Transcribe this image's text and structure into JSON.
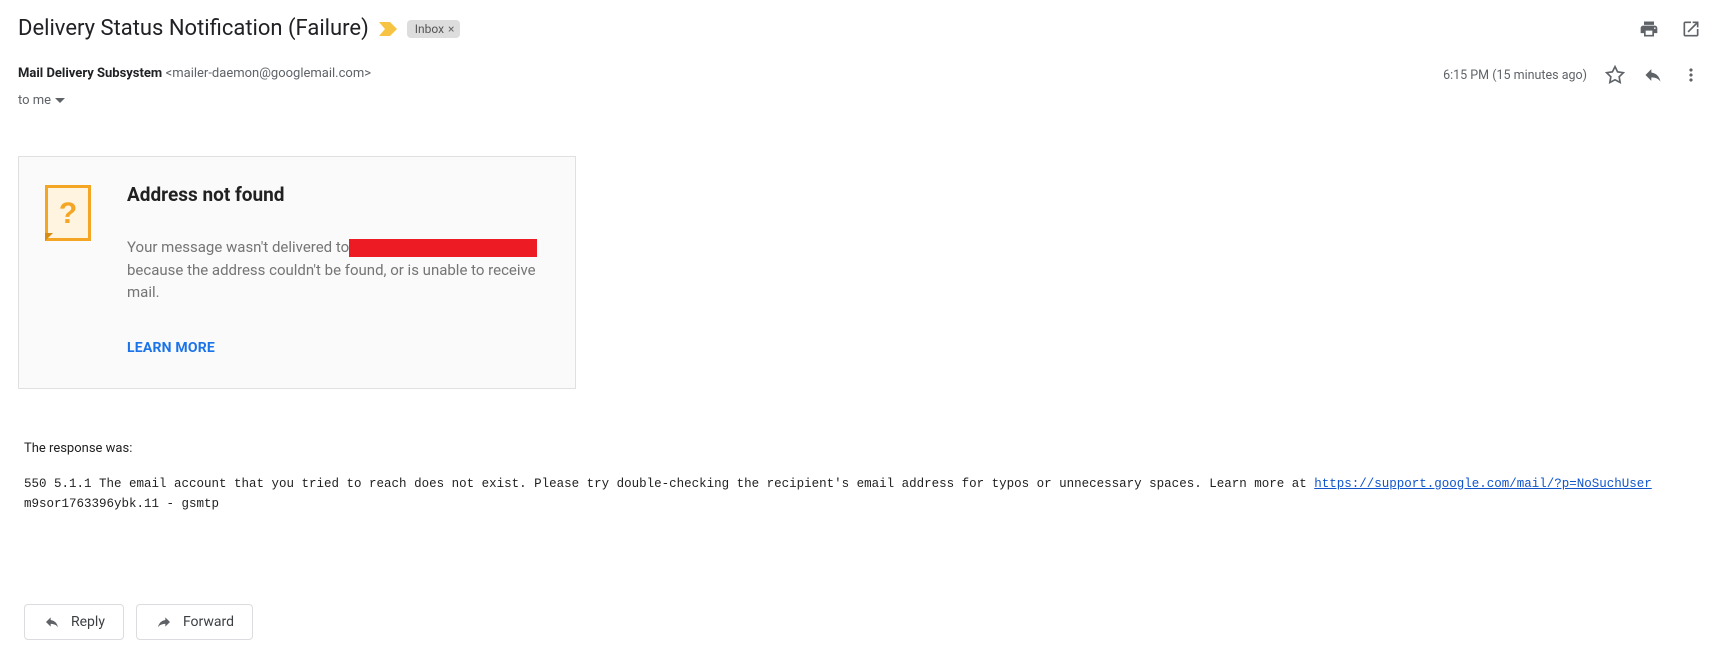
{
  "header": {
    "subject": "Delivery Status Notification (Failure)",
    "label": "Inbox"
  },
  "sender": {
    "name": "Mail Delivery Subsystem",
    "email": "<mailer-daemon@googlemail.com>",
    "timestamp": "6:15 PM (15 minutes ago)",
    "recipient_line": "to me"
  },
  "card": {
    "title": "Address not found",
    "message_before": "Your message wasn't delivered to",
    "message_after": " because the address couldn't be found, or is unable to receive mail.",
    "learn_more": "LEARN MORE"
  },
  "response": {
    "label": "The response was:",
    "text_before_link": "550 5.1.1 The email account that you tried to reach does not exist. Please try double-checking the recipient's email address for typos or unnecessary spaces. Learn more at ",
    "link_text": "https://support.google.com/mail/?p=NoSuchUser",
    "text_after_link": " m9sor1763396ybk.11 - gsmtp"
  },
  "buttons": {
    "reply": "Reply",
    "forward": "Forward"
  }
}
